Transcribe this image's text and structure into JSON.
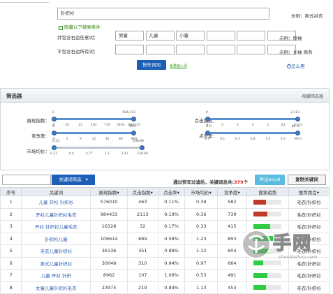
{
  "search": {
    "main_value": "针织衫",
    "main_example": "示例：男式衬衣",
    "hide_conditions": "隐藏以下搜索条件",
    "include_label": "并包含右边任意词：",
    "include_values": [
      "男童",
      "儿童",
      "小童",
      "",
      "",
      ""
    ],
    "include_example": "示例：短袖",
    "exclude_label": "不包含右边所有词：",
    "exclude_values": [
      "",
      "",
      "",
      "",
      "",
      ""
    ],
    "exclude_example": "示例：长袖 商务",
    "submit_label": "快车词词",
    "import_link": "批量输入词",
    "help_link": "怎么用"
  },
  "filter": {
    "title": "筛选器",
    "hide_filter": "-隐藏筛选器",
    "sliders": [
      {
        "label": "展现指数：",
        "min_label": "0",
        "max_label": "984,433",
        "min": 0,
        "max": 984433,
        "ticks": [
          "0",
          "16",
          "25",
          "181",
          "759",
          "3194",
          "984433"
        ]
      },
      {
        "label": "竞争度：",
        "min_label": "0",
        "max_label": "893",
        "min": 0,
        "max": 893,
        "ticks": [
          "0",
          "5",
          "9",
          "22",
          "46",
          "89",
          "893"
        ]
      },
      {
        "label": "市场均价：",
        "min_label": "0.23",
        "max_label": "238.89",
        "min": 0.23,
        "max": 238.89,
        "ticks": [
          "0.23",
          "0.6",
          "0.77",
          "1.1",
          "3.43",
          "238.89"
        ]
      },
      {
        "label": "点击指数：",
        "min_label": "0",
        "max_label": "2,113",
        "min": 0,
        "max": 2113,
        "ticks": [
          "0",
          "0",
          "0",
          "0",
          "5",
          "24",
          "2113"
        ]
      },
      {
        "label": "点击率：",
        "min_label": "0 %",
        "max_label": "89 %",
        "min": 0,
        "max": 89,
        "ticks": [
          "0.0",
          "0.1",
          "0.3",
          "0.8",
          "1.6",
          "4.0",
          "89.0"
        ]
      }
    ]
  },
  "toolbar": {
    "filter_button": "关键词筛选",
    "result_text": "通过快车过滤后，关键词总共:",
    "result_count": "379",
    "result_unit": "个",
    "export_button": "导出excel",
    "copy_button": "复制关键词"
  },
  "table": {
    "headers": [
      "序号",
      "关键词",
      "展现指数",
      "点击指数",
      "点击率",
      "市场均价",
      "竞争度",
      "搜索趋势",
      "推荐类目"
    ],
    "rows": [
      {
        "no": "1",
        "kw": "儿童 开衫 针织衫",
        "impr": "576010",
        "click": "463",
        "ctr": "0.11%",
        "price": "0.39",
        "comp": "582",
        "trend": 0.45,
        "trendColor": "#c0392b",
        "cat": "毛衣/针织衫"
      },
      {
        "no": "2",
        "kw": "开衫儿童针织衫毛衣",
        "impr": "984433",
        "click": "2113",
        "ctr": "0.19%",
        "price": "0.36",
        "comp": "739",
        "trend": 0.5,
        "trendColor": "#c0392b",
        "cat": "毛衣/针织衫"
      },
      {
        "no": "3",
        "kw": "开衫 针织衫儿童毛衣",
        "impr": "16328",
        "click": "32",
        "ctr": "0.17%",
        "price": "0.33",
        "comp": "415",
        "trend": 0.6,
        "trendColor": "#2ecc40",
        "cat": "毛衣/针织衫"
      },
      {
        "no": "4",
        "kw": "针织衫儿童",
        "impr": "106614",
        "click": "689",
        "ctr": "0.58%",
        "price": "1.23",
        "comp": "893",
        "trend": 0.7,
        "trendColor": "#2ecc40",
        "cat": "毛衣/针织衫"
      },
      {
        "no": "5",
        "kw": "毛衣儿童针织衫",
        "impr": "36136",
        "click": "351",
        "ctr": "0.88%",
        "price": "1.12",
        "comp": "604",
        "trend": 0.55,
        "trendColor": "#2ecc40",
        "cat": "毛衣/针织衫"
      },
      {
        "no": "6",
        "kw": "男式儿童针织衫",
        "impr": "30048",
        "click": "310",
        "ctr": "0.94%",
        "price": "0.97",
        "comp": "664",
        "trend": 0.35,
        "trendColor": "#2ecc40",
        "cat": "毛衣/针织衫"
      },
      {
        "no": "7",
        "kw": "儿童 开衫 针织",
        "impr": "8962",
        "click": "107",
        "ctr": "1.09%",
        "price": "0.53",
        "comp": "491",
        "trend": 0.5,
        "trendColor": "#2ecc40",
        "cat": "毛衣/针织衫"
      },
      {
        "no": "8",
        "kw": "女童儿童针织衫毛衣",
        "impr": "23975",
        "click": "219",
        "ctr": "0.84%",
        "price": "1.13",
        "comp": "453",
        "trend": 0.45,
        "trendColor": "#2ecc40",
        "cat": "毛衣/针织衫"
      }
    ]
  },
  "watermark": {
    "main": "手网",
    "sub": "shoudashou.com"
  },
  "colors": {
    "accent": "#1d5fb8",
    "export": "#5bbbe0",
    "count": "#e0211d"
  }
}
